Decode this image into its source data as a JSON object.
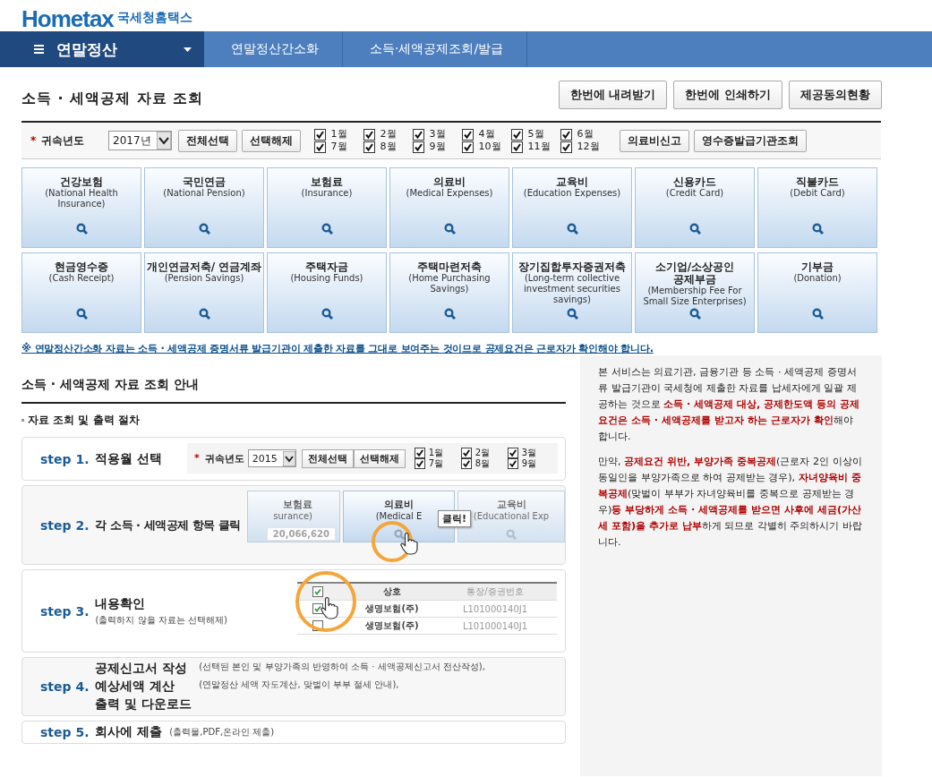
{
  "logo": {
    "brand": "Hometax",
    "name": "국세청홈택스"
  },
  "nav": {
    "menu": "연말정산",
    "crumbs": [
      "연말정산간소화",
      "소득·세액공제조회/발급"
    ]
  },
  "page_title": "소득 · 세액공제 자료 조회",
  "top_buttons": [
    "한번에 내려받기",
    "한번에 인쇄하기",
    "제공동의현황"
  ],
  "filter": {
    "required_mark": "*",
    "label": "귀속년도",
    "year": "2017년",
    "buttons": [
      "전체선택",
      "선택해제"
    ],
    "months": [
      {
        "label": "1월",
        "checked": true
      },
      {
        "label": "2월",
        "checked": true
      },
      {
        "label": "3월",
        "checked": true
      },
      {
        "label": "4월",
        "checked": true
      },
      {
        "label": "5월",
        "checked": true
      },
      {
        "label": "6월",
        "checked": true
      },
      {
        "label": "7월",
        "checked": true
      },
      {
        "label": "8월",
        "checked": true
      },
      {
        "label": "9월",
        "checked": true
      },
      {
        "label": "10월",
        "checked": true
      },
      {
        "label": "11월",
        "checked": true
      },
      {
        "label": "12월",
        "checked": true
      }
    ],
    "extra_buttons": [
      "의료비신고",
      "영수증발급기관조회"
    ]
  },
  "categories": [
    {
      "name": "건강보험",
      "english": "(National Health Insurance)"
    },
    {
      "name": "국민연금",
      "english": "(National Pension)"
    },
    {
      "name": "보험료",
      "english": "(Insurance)"
    },
    {
      "name": "의료비",
      "english": "(Medical Expenses)"
    },
    {
      "name": "교육비",
      "english": "(Education Expenses)"
    },
    {
      "name": "신용카드",
      "english": "(Credit Card)"
    },
    {
      "name": "직불카드",
      "english": "(Debit Card)"
    },
    {
      "name": "현금영수증",
      "english": "(Cash Receipt)"
    },
    {
      "name": "개인연금저축/ 연금계좌",
      "english": "(Pension Savings)"
    },
    {
      "name": "주택자금",
      "english": "(Housing Funds)"
    },
    {
      "name": "주택마련저축",
      "english": "(Home Purchasing Savings)"
    },
    {
      "name": "장기집합투자증권저축",
      "english": "(Long-term collective investment securities savings)"
    },
    {
      "name": "소기업/소상공인 공제부금",
      "english": "(Membership Fee For Small Size Enterprises)"
    },
    {
      "name": "기부금",
      "english": "(Donation)"
    }
  ],
  "notice": "※ 연말정산간소화 자료는 소득 · 세액공제 증명서류 발급기관이 제출한 자료를 그대로 보여주는 것이므로 공제요건은 근로자가 확인해야 합니다.",
  "guide": {
    "title": "소득 · 세액공제 자료 조회 안내",
    "subtitle": "자료 조회 및 출력 절차",
    "steps": [
      {
        "kind": "filter",
        "label": "step 1.",
        "titles": [
          "적용월 선택"
        ],
        "demo": {
          "required_mark": "*",
          "label": "귀속년도",
          "year": "2015",
          "buttons": [
            "전체선택",
            "선택해제"
          ],
          "months": [
            {
              "label": "1월",
              "checked": true
            },
            {
              "label": "2월",
              "checked": true
            },
            {
              "label": "3월",
              "checked": true
            },
            {
              "label": "7월",
              "checked": true
            },
            {
              "label": "8월",
              "checked": true
            },
            {
              "label": "9월",
              "checked": true
            }
          ]
        }
      },
      {
        "kind": "tiles",
        "label": "step 2.",
        "titles": [
          "각 소득 · 세액공제 항목 클릭"
        ],
        "demo": {
          "tiles": [
            {
              "name": "보험료",
              "english": "surance)",
              "amount": "20,066,620"
            },
            {
              "name": "의료비",
              "english": "(Medical E"
            },
            {
              "name": "교육비",
              "english": "(Educational Exp"
            }
          ],
          "tooltip": "클릭!"
        }
      },
      {
        "kind": "table",
        "label": "step 3.",
        "titles": [
          "내용확인"
        ],
        "notes": [
          "(출력하지 않을 자료는 선택해제)"
        ],
        "demo": {
          "columns": [
            "상호",
            "통장/증권번호"
          ],
          "header_checked": true,
          "rows": [
            {
              "cells": [
                "생명보험(주)",
                "L101000140J1"
              ],
              "checked": true
            },
            {
              "cells": [
                "생명보험(주)",
                "L101000140J1"
              ],
              "checked": false
            }
          ]
        }
      },
      {
        "kind": "text",
        "label": "step 4.",
        "titles": [
          "공제신고서 작성",
          "예상세액 계산",
          "출력 및 다운로드"
        ],
        "notes": [
          "(선택된 본인 및 부양가족의 반영하여 소득 · 세액공제신고서 전산작성),",
          "(연말정산 세액 자도계산, 맞벌이 부부 절세 안내),"
        ]
      },
      {
        "kind": "text",
        "label": "step 5.",
        "titles": [
          "회사에 제출"
        ],
        "notes": [
          "(출력물,PDF,온라인 제출)"
        ]
      }
    ]
  },
  "side_panel": [
    "본 서비스는 의료기관, 금융기관 등 소득 · 세액공제 증명서류 발급기관이 국세청에 제출한 자료를 납세자에게 일괄 제공하는 것으로 **소득 · 세액공제 대상, 공제한도액 등의 공제요건은 소득 · 세액공제를 받고자 하는 근로자가 확인**해야 합니다.",
    "만약, **공제요건 위반, 부양가족 중복공제**(근로자 2인 이상이 동일인을 부양가족으로 하여 공제받는 경우), **자녀양육비 중복공제**(맞벌이 부부가 자녀양육비를 중복으로 공제받는 경우)**등 부당하게 소득 · 세액공제를 받으면 사후에 세금(가산세 포함)을 추가로 납부**하게 되므로 각별히 주의하시기 바랍니다."
  ]
}
